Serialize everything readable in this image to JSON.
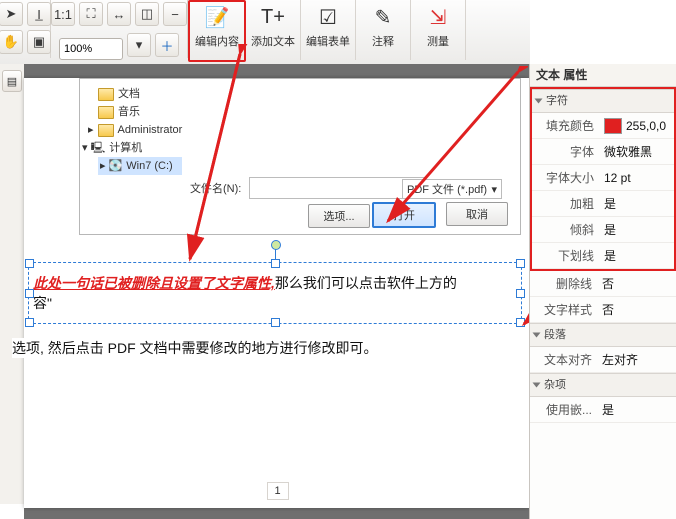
{
  "toolbar": {
    "zoom_value": "100%",
    "edit_content": "编辑内容",
    "add_text": "添加文本",
    "edit_form": "编辑表单",
    "annotate": "注释",
    "measure": "测量"
  },
  "left_strip": {
    "tab": "▤"
  },
  "dialog": {
    "tree": {
      "docs": "文档",
      "music": "音乐",
      "admin": "Administrator",
      "computer": "计算机",
      "drive": "Win7 (C:)"
    },
    "filename_label": "文件名(N):",
    "filetype": "PDF 文件 (*.pdf)",
    "options": "选项...",
    "open": "打开",
    "cancel": "取消"
  },
  "editbox": {
    "red": "此处一句话已被删除且设置了文字属性,",
    "plain": "那么我们可以点击软件上方的",
    "trail": "容\""
  },
  "line2": "选项, 然后点击 PDF 文档中需要修改的地方进行修改即可。",
  "page_number": "1",
  "props": {
    "title": "文本 属性",
    "sec_char": "字符",
    "fill_color_label": "填充颜色",
    "fill_color_value": "255,0,0",
    "font_label": "字体",
    "font_value": "微软雅黑",
    "size_label": "字体大小",
    "size_value": "12 pt",
    "bold_label": "加粗",
    "bold_value": "是",
    "italic_label": "倾斜",
    "italic_value": "是",
    "underline_label": "下划线",
    "underline_value": "是",
    "strike_label": "删除线",
    "strike_value": "否",
    "charstyle_label": "文字样式",
    "charstyle_value": "否",
    "sec_para": "段落",
    "align_label": "文本对齐",
    "align_value": "左对齐",
    "sec_misc": "杂项",
    "embed_label": "使用嵌...",
    "embed_value": "是"
  }
}
